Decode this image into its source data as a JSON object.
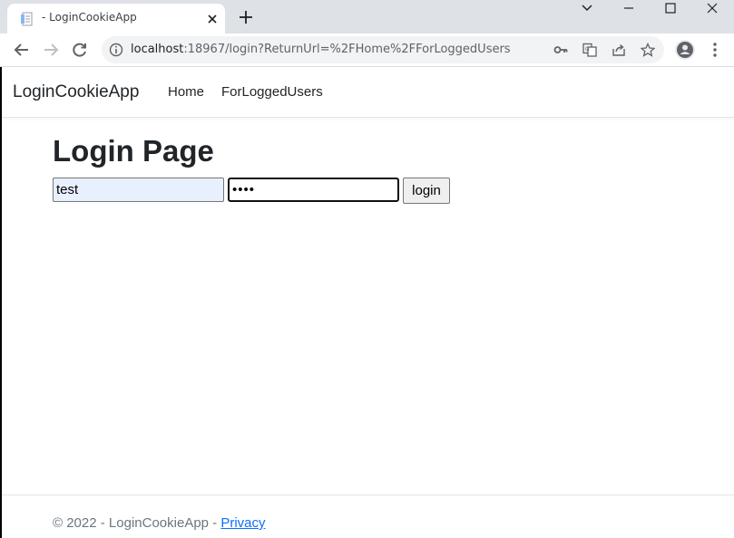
{
  "browser": {
    "tab_title": "- LoginCookieApp",
    "url_host": "localhost",
    "url_rest": ":18967/login?ReturnUrl=%2FHome%2FForLoggedUsers"
  },
  "navbar": {
    "brand": "LoginCookieApp",
    "links": [
      {
        "label": "Home"
      },
      {
        "label": "ForLoggedUsers"
      }
    ]
  },
  "main": {
    "heading": "Login Page",
    "username_value": "test",
    "password_value": "••••",
    "login_button": "login"
  },
  "footer": {
    "copyright": "© 2022 - LoginCookieApp - ",
    "privacy_link": "Privacy"
  },
  "colors": {
    "autofill_bg": "#e8f0fe",
    "link": "#0d6efd",
    "footer_text": "#6c757d"
  }
}
